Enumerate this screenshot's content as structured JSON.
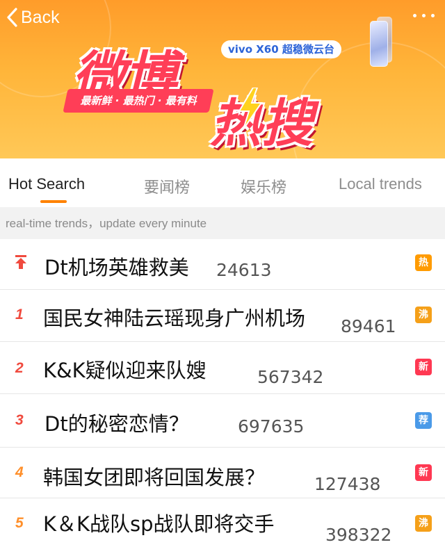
{
  "nav": {
    "back_label": "Back"
  },
  "banner": {
    "logo_line1": "微博",
    "logo_line2": "热搜",
    "tagline": "最新鲜 · 最热门 · 最有料",
    "sponsor": "vivo X60 超稳微云台"
  },
  "tabs": [
    {
      "label": "Hot Search",
      "active": true
    },
    {
      "label": "要闻榜",
      "active": false
    },
    {
      "label": "娱乐榜",
      "active": false
    },
    {
      "label": "Local trends",
      "active": false
    }
  ],
  "notice": "real-time trends，update every minute",
  "colors": {
    "accent": "#ff8200",
    "rank_top": "#f04a3e",
    "rank_mid": "#ff8f2a",
    "badge_hot": "#ff9b00",
    "badge_boil": "#f5a019",
    "badge_new": "#ff3852",
    "badge_rec": "#4a9ae8"
  },
  "items": [
    {
      "rank": "",
      "pinned": true,
      "title": "Dt机场英雄救美",
      "count": "24613",
      "badge": "热",
      "badge_type": "hot"
    },
    {
      "rank": "1",
      "pinned": false,
      "title": "国民女神陆云瑶现身广州机场",
      "count": "89461",
      "badge": "沸",
      "badge_type": "boil"
    },
    {
      "rank": "2",
      "pinned": false,
      "title": "K&K疑似迎来队嫂",
      "count": "567342",
      "badge": "新",
      "badge_type": "new"
    },
    {
      "rank": "3",
      "pinned": false,
      "title": "Dt的秘密恋情？",
      "count": "697635",
      "badge": "荐",
      "badge_type": "rec"
    },
    {
      "rank": "4",
      "pinned": false,
      "title": "韩国女团即将回国发展？",
      "count": "127438",
      "badge": "新",
      "badge_type": "new"
    },
    {
      "rank": "5",
      "pinned": false,
      "title": "K＆K战队sp战队即将交手",
      "count": "398322",
      "badge": "沸",
      "badge_type": "boil"
    }
  ]
}
